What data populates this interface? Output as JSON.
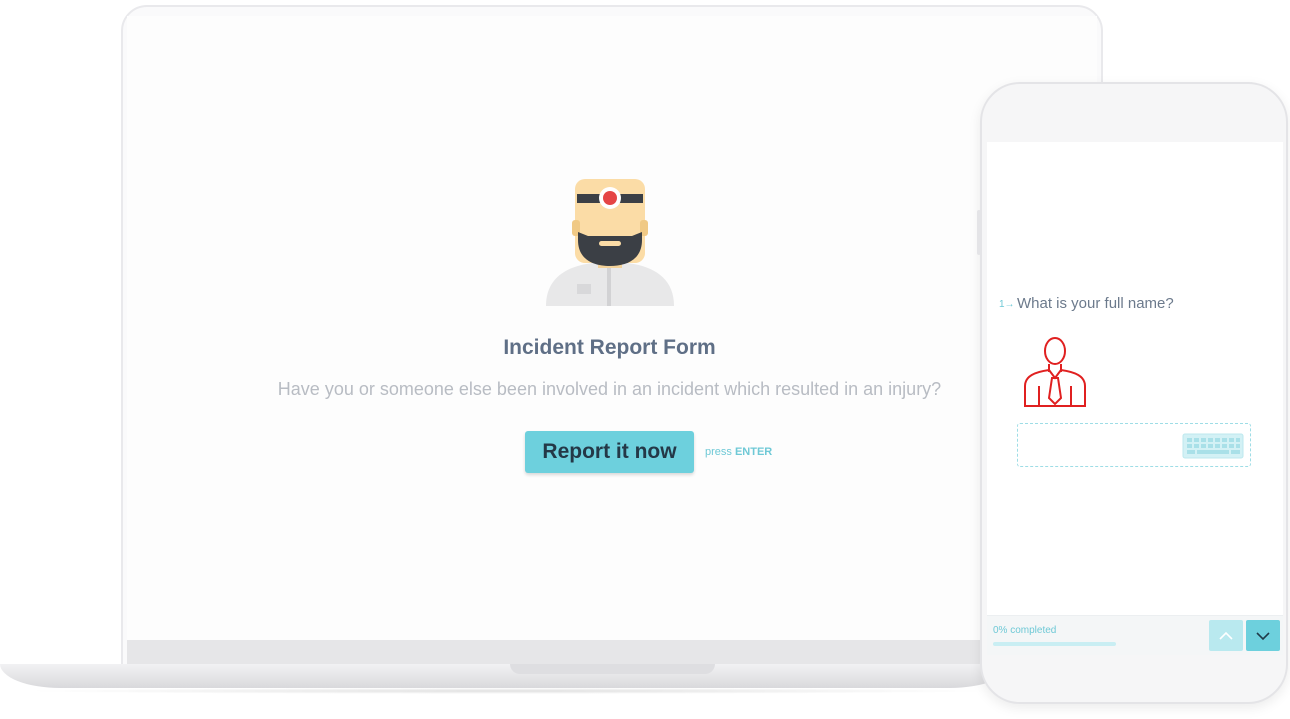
{
  "desktop": {
    "form_title": "Incident Report Form",
    "form_subtitle": "Have you or someone else been involved in an incident which resulted in an injury?",
    "cta_label": "Report it now",
    "hint_prefix": "press",
    "hint_key": "ENTER",
    "avatar_icon": "doctor-avatar-icon"
  },
  "mobile": {
    "question_number": "1→",
    "question_text": "What is your full name?",
    "input_value": "",
    "question_icon": "businessman-icon",
    "input_icon": "keyboard-icon",
    "progress_label": "0% completed",
    "progress_fraction": 0,
    "nav_up_icon": "chevron-up-icon",
    "nav_down_icon": "chevron-down-icon"
  },
  "colors": {
    "accent": "#6dd0dd",
    "accent_light": "#b9e9ef",
    "title": "#5f6f86",
    "subtitle": "#b8bcc3",
    "icon_red": "#e02020"
  }
}
